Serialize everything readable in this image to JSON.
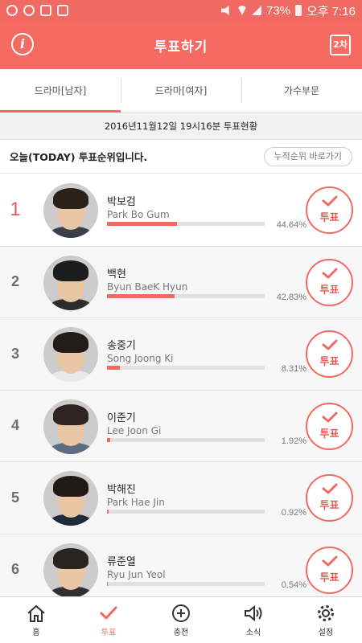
{
  "status_bar": {
    "battery": "73%",
    "time": "오후 7:16"
  },
  "header": {
    "title": "투표하기",
    "info_icon": "i",
    "round_label": "2차"
  },
  "tabs": [
    {
      "label": "드라마[남자]",
      "active": true
    },
    {
      "label": "드라마[여자]",
      "active": false
    },
    {
      "label": "가수부문",
      "active": false
    }
  ],
  "timestamp": "2016년11월12일 19시16분 투표현황",
  "ranking": {
    "heading": "오늘(TODAY) 투표순위입니다.",
    "cumulative_button": "누적순위 바로가기"
  },
  "vote_label": "투표",
  "accent_color": "#f06a63",
  "candidates": [
    {
      "rank": "1",
      "name": "박보검",
      "english_name": "Park Bo Gum",
      "percent": "44.64%",
      "fill": 0.4464
    },
    {
      "rank": "2",
      "name": "백현",
      "english_name": "Byun BaeK Hyun",
      "percent": "42.83%",
      "fill": 0.4283
    },
    {
      "rank": "3",
      "name": "송중기",
      "english_name": "Song Joong Ki",
      "percent": "8.31%",
      "fill": 0.0831
    },
    {
      "rank": "4",
      "name": "이준기",
      "english_name": "Lee Joon Gi",
      "percent": "1.92%",
      "fill": 0.0192
    },
    {
      "rank": "5",
      "name": "박해진",
      "english_name": "Park Hae Jin",
      "percent": "0.92%",
      "fill": 0.0092
    },
    {
      "rank": "6",
      "name": "류준열",
      "english_name": "Ryu Jun Yeol",
      "percent": "0.54%",
      "fill": 0.0054
    }
  ],
  "bottom_nav": [
    {
      "label": "홈",
      "icon": "home-icon",
      "active": false
    },
    {
      "label": "투표",
      "icon": "check-icon",
      "active": true
    },
    {
      "label": "충전",
      "icon": "plus-circle-icon",
      "active": false
    },
    {
      "label": "소식",
      "icon": "speaker-icon",
      "active": false
    },
    {
      "label": "설정",
      "icon": "gear-icon",
      "active": false
    }
  ]
}
